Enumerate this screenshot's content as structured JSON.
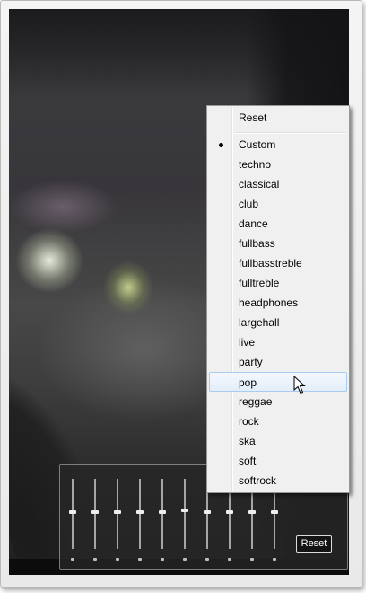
{
  "menu": {
    "reset_label": "Reset",
    "presets": [
      "Custom",
      "techno",
      "classical",
      "club",
      "dance",
      "fullbass",
      "fullbasstreble",
      "fulltreble",
      "headphones",
      "largehall",
      "live",
      "party",
      "pop",
      "reggae",
      "rock",
      "ska",
      "soft",
      "softrock"
    ],
    "selected_preset": "Custom",
    "hovered_preset": "pop"
  },
  "equalizer": {
    "band_count": 10,
    "reset_label": "Reset"
  },
  "colors": {
    "menu_background": "#f0f0f0",
    "hover_highlight": "#e3eefa",
    "hover_border": "#a8cbef"
  },
  "icons": {
    "cursor": "mouse-pointer-icon",
    "selected_marker": "bullet-icon"
  }
}
